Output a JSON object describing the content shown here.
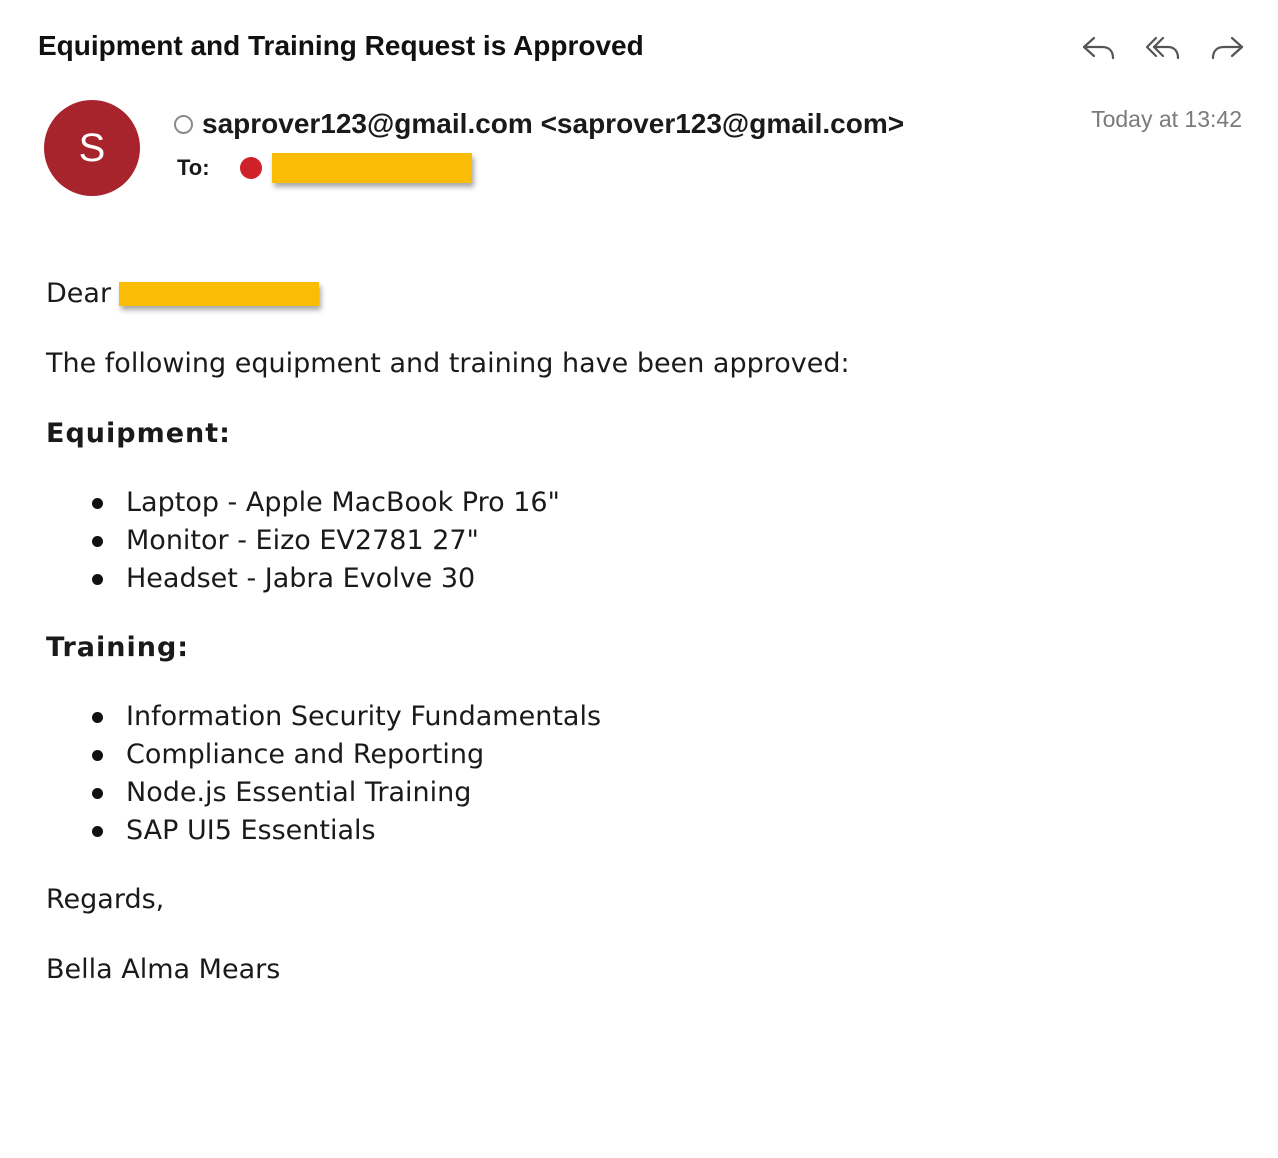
{
  "subject": "Equipment and Training Request is Approved",
  "toolbar": {
    "actions": [
      {
        "name": "reply",
        "icon": "reply-icon"
      },
      {
        "name": "reply-all",
        "icon": "reply-all-icon"
      },
      {
        "name": "forward",
        "icon": "forward-icon"
      }
    ]
  },
  "header": {
    "avatar_letter": "S",
    "avatar_color": "#a8242c",
    "sender": "saprover123@gmail.com <saprover123@gmail.com>",
    "to_label": "To:",
    "redaction_color": "#fbbc05",
    "recipient_dot_color": "#d0202a",
    "timestamp": "Today at 13:42"
  },
  "body": {
    "greeting": "Dear",
    "intro": "The following equipment and training have been approved:",
    "equipment_heading": "Equipment:",
    "equipment": [
      "Laptop - Apple MacBook Pro 16\"",
      "Monitor - Eizo EV2781 27\"",
      "Headset - Jabra Evolve 30"
    ],
    "training_heading": "Training:",
    "training": [
      "Information Security Fundamentals",
      "Compliance and Reporting",
      "Node.js Essential Training",
      "SAP UI5 Essentials"
    ],
    "closing": "Regards,",
    "signature": "Bella Alma Mears"
  }
}
